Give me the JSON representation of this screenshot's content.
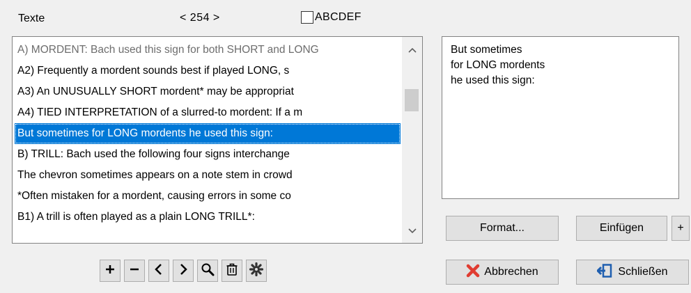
{
  "header": {
    "title": "Texte",
    "nav": "< 254 >",
    "checkbox_label": "ABCDEF",
    "checkbox_checked": false
  },
  "list": {
    "items": [
      "A) MORDENT: Bach used this sign for both SHORT and LONG",
      "A2) Frequently a mordent sounds best if played LONG, s",
      "A3) An UNUSUALLY SHORT mordent* may be appropriat",
      "A4) TIED INTERPRETATION of a slurred-to mordent: If a m",
      "But sometimes for LONG mordents he used this sign:",
      "B) TRILL: Bach used the following four signs interchange",
      "The chevron sometimes appears on a note stem in crowd",
      "*Often mistaken for a mordent, causing errors in some co",
      "B1) A trill is often played as a plain LONG TRILL*:"
    ],
    "selected_index": 4
  },
  "preview": {
    "lines": [
      "But sometimes",
      "for LONG mordents",
      "he used this sign:"
    ]
  },
  "buttons": {
    "format": "Format...",
    "insert": "Einfügen",
    "insert_plus": "+",
    "cancel": "Abbrechen",
    "close": "Schließen"
  },
  "toolbar": {
    "icons": [
      "plus-icon",
      "minus-icon",
      "chevron-left-icon",
      "chevron-right-icon",
      "search-icon",
      "trash-icon",
      "gear-icon"
    ]
  },
  "colors": {
    "selection": "#0078d7",
    "cancel_icon": "#e03c31",
    "close_icon": "#1f5fb0"
  }
}
